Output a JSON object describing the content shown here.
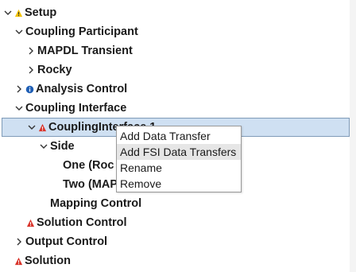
{
  "tree": {
    "setup": "Setup",
    "coupling_participant": "Coupling Participant",
    "mapdl_transient": "MAPDL Transient",
    "rocky": "Rocky",
    "analysis_control": "Analysis Control",
    "coupling_interface": "Coupling Interface",
    "coupling_interface_1": "CouplingInterface 1",
    "side": "Side",
    "one": "One (Roc",
    "two": "Two (MAP",
    "mapping_control": "Mapping Control",
    "solution_control": "Solution Control",
    "output_control": "Output Control",
    "solution": "Solution"
  },
  "context_menu": {
    "items": [
      "Add Data Transfer",
      "Add FSI Data Transfers",
      "Rename",
      "Remove"
    ],
    "hovered_index": 1
  },
  "colors": {
    "selection_bg": "#cfe0f2",
    "warning_yellow": "#f2c200",
    "error_red": "#d9342b",
    "info_blue": "#1f5fb5"
  },
  "icons": [
    "chevron-down-icon",
    "chevron-right-icon",
    "warning-icon",
    "error-icon",
    "info-icon"
  ]
}
